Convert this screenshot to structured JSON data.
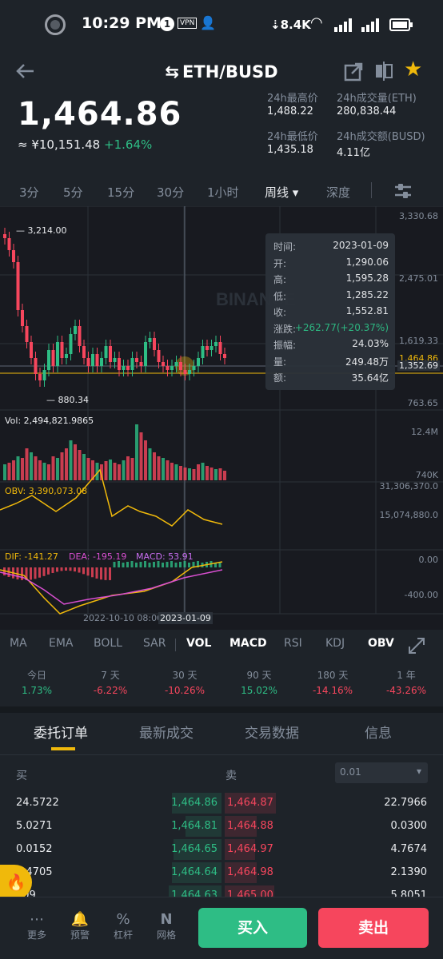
{
  "status_bar": {
    "time": "10:29 PM",
    "speed": "8.4K",
    "notif_count": "1",
    "vpn": "VPN"
  },
  "header": {
    "pair": "ETH/BUSD"
  },
  "ticker": {
    "price": "1,464.86",
    "cny": "≈ ¥10,151.48",
    "change": "+1.64%",
    "high_label": "24h最高价",
    "high": "1,488.22",
    "vol_eth_label": "24h成交量(ETH)",
    "vol_eth": "280,838.44",
    "low_label": "24h最低价",
    "low": "1,435.18",
    "vol_busd_label": "24h成交额(BUSD)",
    "vol_busd": "4.11亿"
  },
  "timeframes": [
    "3分",
    "5分",
    "15分",
    "30分",
    "1小时",
    "周线",
    "深度"
  ],
  "colors": {
    "up": "#2ebd85",
    "down": "#f6465d",
    "accent": "#f0b90b",
    "bg": "#1e2329",
    "chart_bg": "#181a20"
  },
  "chart": {
    "watermark": "BINANCE",
    "price_axis": [
      "3,330.68",
      "2,475.01",
      "1,619.33",
      "763.65"
    ],
    "max_label": "3,214.00",
    "min_label": "880.34",
    "current_price_tag": "1,464.86",
    "cross_price_tag": "1,352.69",
    "vol_title": "Vol: 2,494,821.9865",
    "vol_axis": [
      "12.4M",
      "740K"
    ],
    "obv_title": "OBV: 3,390,073.08",
    "obv_axis": [
      "31,306,370.0",
      "15,074,880.0"
    ],
    "macd_dif": "DIF: -141.27",
    "macd_dea": "DEA: -195.19",
    "macd_val": "MACD: 53.91",
    "macd_axis": [
      "0.00",
      "-400.00"
    ],
    "date_left": "2022-10-10 08:00",
    "date_cursor": "2023-01-09"
  },
  "tooltip": {
    "rows": [
      {
        "k": "时间:",
        "v": "2023-01-09"
      },
      {
        "k": "开:",
        "v": "1,290.06"
      },
      {
        "k": "高:",
        "v": "1,595.28"
      },
      {
        "k": "低:",
        "v": "1,285.22"
      },
      {
        "k": "收:",
        "v": "1,552.81"
      },
      {
        "k": "涨跌:",
        "v": "+262.77(+20.37%)"
      },
      {
        "k": "振幅:",
        "v": "24.03%"
      },
      {
        "k": "量:",
        "v": "249.48万"
      },
      {
        "k": "额:",
        "v": "35.64亿"
      }
    ]
  },
  "indicators": [
    "MA",
    "EMA",
    "BOLL",
    "SAR",
    "VOL",
    "MACD",
    "RSI",
    "KDJ",
    "OBV"
  ],
  "performance": [
    {
      "period": "今日",
      "value": "1.73%"
    },
    {
      "period": "7 天",
      "value": "-6.22%"
    },
    {
      "period": "30 天",
      "value": "-10.26%"
    },
    {
      "period": "90 天",
      "value": "15.02%"
    },
    {
      "period": "180 天",
      "value": "-14.16%"
    },
    {
      "period": "1 年",
      "value": "-43.26%"
    }
  ],
  "tabs": [
    "委托订单",
    "最新成交",
    "交易数据",
    "信息"
  ],
  "orderbook": {
    "buy_label": "买",
    "sell_label": "卖",
    "precision": "0.01",
    "rows": [
      {
        "bq": "24.5722",
        "bp": "1,464.86",
        "ap": "1,464.87",
        "aq": "22.7966"
      },
      {
        "bq": "5.0271",
        "bp": "1,464.81",
        "ap": "1,464.88",
        "aq": "0.0300"
      },
      {
        "bq": "0.0152",
        "bp": "1,464.65",
        "ap": "1,464.97",
        "aq": "4.7674"
      },
      {
        "bq": "1.4705",
        "bp": "1,464.64",
        "ap": "1,464.98",
        "aq": "2.1390"
      },
      {
        "bq": "509",
        "bp": "1,464.63",
        "ap": "1,465.00",
        "aq": "5.8051"
      }
    ]
  },
  "bottom_nav": {
    "more": "更多",
    "alert": "预警",
    "leverage": "杠杆",
    "grid": "网格",
    "buy": "买入",
    "sell": "卖出"
  }
}
